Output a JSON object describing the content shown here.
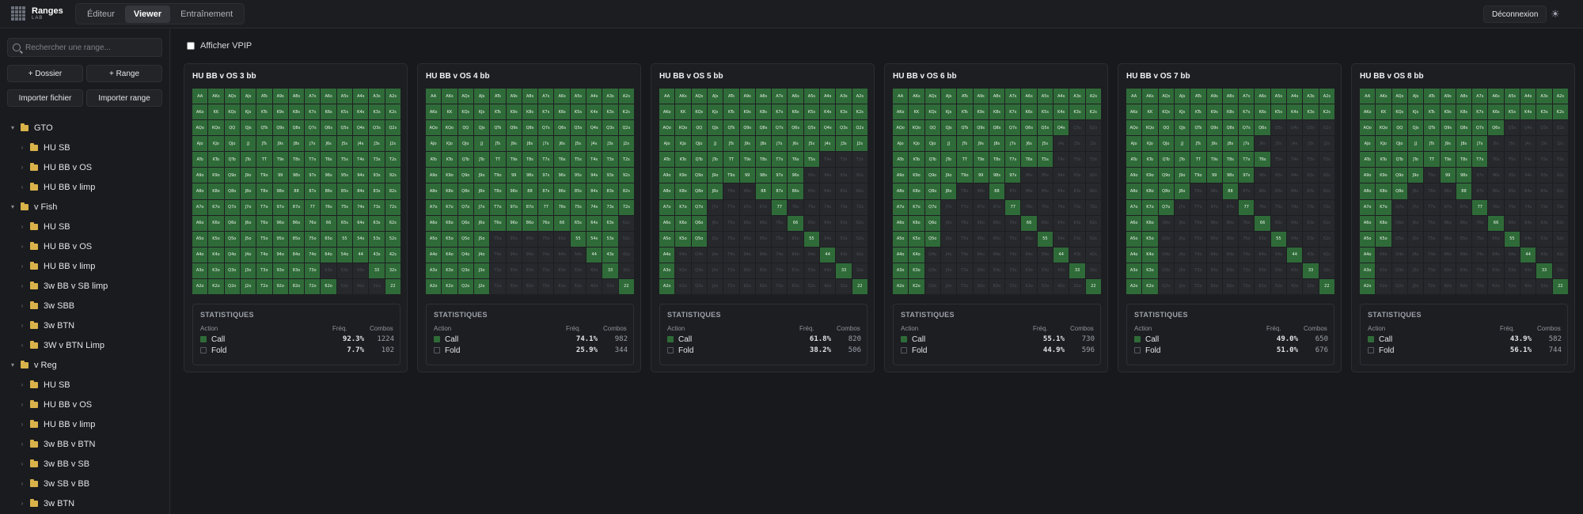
{
  "app": {
    "name": "Ranges",
    "sub": "LAB"
  },
  "nav": {
    "tabs": [
      "Éditeur",
      "Viewer",
      "Entraînement"
    ],
    "active": "Viewer"
  },
  "header": {
    "logout": "Déconnexion"
  },
  "sidebar": {
    "search_placeholder": "Rechercher une range...",
    "buttons": {
      "add_folder": "+ Dossier",
      "add_range": "+ Range",
      "import_file": "Importer fichier",
      "import_range": "Importer range"
    },
    "tree": [
      {
        "label": "GTO",
        "level": 0
      },
      {
        "label": "HU SB",
        "level": 1
      },
      {
        "label": "HU BB v OS",
        "level": 1
      },
      {
        "label": "HU BB v limp",
        "level": 1
      },
      {
        "label": "v Fish",
        "level": 0
      },
      {
        "label": "HU SB",
        "level": 1
      },
      {
        "label": "HU BB v OS",
        "level": 1
      },
      {
        "label": "HU BB v limp",
        "level": 1
      },
      {
        "label": "3w BB v SB limp",
        "level": 1
      },
      {
        "label": "3w SBB",
        "level": 1
      },
      {
        "label": "3w BTN",
        "level": 1
      },
      {
        "label": "3W v BTN Limp",
        "level": 1
      },
      {
        "label": "v Reg",
        "level": 0
      },
      {
        "label": "HU SB",
        "level": 1
      },
      {
        "label": "HU BB v OS",
        "level": 1
      },
      {
        "label": "HU BB v limp",
        "level": 1
      },
      {
        "label": "3w BB v BTN",
        "level": 1
      },
      {
        "label": "3w BB v SB",
        "level": 1
      },
      {
        "label": "3w SB v BB",
        "level": 1
      },
      {
        "label": "3w BTN",
        "level": 1
      }
    ]
  },
  "main": {
    "vpip_label": "Afficher VPIP"
  },
  "colors": {
    "call": "#2f6b38",
    "fold": "#26282c",
    "accent": "#d9b24a"
  },
  "labels": {
    "stats_title": "STATISTIQUES",
    "action": "Action",
    "freq": "Fréq.",
    "combos": "Combos"
  },
  "ranks": [
    "A",
    "K",
    "Q",
    "J",
    "T",
    "9",
    "8",
    "7",
    "6",
    "5",
    "4",
    "3",
    "2"
  ],
  "panels": [
    {
      "title": "HU BB v OS 3 bb",
      "fold_hands": [
        "63o",
        "53o",
        "43o",
        "52o",
        "42o",
        "32o"
      ],
      "stats": [
        {
          "action": "Call",
          "freq": "92.3%",
          "combos": "1224"
        },
        {
          "action": "Fold",
          "freq": "7.7%",
          "combos": "102"
        }
      ]
    },
    {
      "title": "HU BB v OS 4 bb",
      "fold_hands": [
        "62s",
        "52s",
        "42s",
        "32s",
        "T5o",
        "95o",
        "85o",
        "75o",
        "65o",
        "T4o",
        "94o",
        "84o",
        "74o",
        "64o",
        "54o",
        "T3o",
        "93o",
        "83o",
        "73o",
        "63o",
        "53o",
        "43o",
        "T2o",
        "92o",
        "82o",
        "72o",
        "62o",
        "52o",
        "42o",
        "32o"
      ],
      "stats": [
        {
          "action": "Call",
          "freq": "74.1%",
          "combos": "982"
        },
        {
          "action": "Fold",
          "freq": "25.9%",
          "combos": "344"
        }
      ]
    },
    {
      "title": "HU BB v OS 5 bb",
      "fold_hands": [
        "T2s",
        "92s",
        "82s",
        "72s",
        "62s",
        "52s",
        "42s",
        "32s",
        "T3s",
        "93s",
        "83s",
        "73s",
        "63s",
        "53s",
        "43s",
        "T4s",
        "94s",
        "84s",
        "74s",
        "64s",
        "54s",
        "95s",
        "85s",
        "75s",
        "65s",
        "76s",
        "J6o",
        "T6o",
        "96o",
        "86o",
        "76o",
        "J5o",
        "T5o",
        "95o",
        "85o",
        "75o",
        "65o",
        "J4o",
        "T4o",
        "94o",
        "84o",
        "74o",
        "64o",
        "54o",
        "J3o",
        "T3o",
        "93o",
        "83o",
        "73o",
        "63o",
        "53o",
        "43o",
        "J2o",
        "T2o",
        "92o",
        "82o",
        "72o",
        "62o",
        "52o",
        "42o",
        "32o",
        "K2o",
        "Q2o",
        "K3o",
        "Q3o",
        "K4o",
        "Q4o",
        "97o",
        "87o",
        "J7o",
        "T7o",
        "T8o",
        "98o"
      ],
      "stats": [
        {
          "action": "Call",
          "freq": "61.8%",
          "combos": "820"
        },
        {
          "action": "Fold",
          "freq": "38.2%",
          "combos": "506"
        }
      ]
    },
    {
      "title": "HU BB v OS 6 bb",
      "fold_hands": [
        "32s",
        "42s",
        "52s",
        "62s",
        "72s",
        "82s",
        "92s",
        "T2s",
        "43s",
        "53s",
        "63s",
        "73s",
        "83s",
        "93s",
        "T3s",
        "54s",
        "64s",
        "74s",
        "84s",
        "94s",
        "T4s",
        "65s",
        "75s",
        "85s",
        "95s",
        "76s",
        "86s",
        "96s",
        "87s",
        "J2s",
        "J3s",
        "J4s",
        "Q3s",
        "Q2s",
        "97o",
        "87o",
        "J7o",
        "T7o",
        "T8o",
        "98o",
        "J6o",
        "T6o",
        "96o",
        "86o",
        "76o",
        "J5o",
        "T5o",
        "95o",
        "85o",
        "75o",
        "65o",
        "J4o",
        "T4o",
        "94o",
        "84o",
        "74o",
        "64o",
        "54o",
        "Q4o",
        "J3o",
        "T3o",
        "93o",
        "83o",
        "73o",
        "63o",
        "53o",
        "43o",
        "Q3o",
        "Q2o",
        "J2o",
        "T2o",
        "92o",
        "82o",
        "72o",
        "62o",
        "52o",
        "42o",
        "32o"
      ],
      "stats": [
        {
          "action": "Call",
          "freq": "55.1%",
          "combos": "730"
        },
        {
          "action": "Fold",
          "freq": "44.9%",
          "combos": "596"
        }
      ]
    },
    {
      "title": "HU BB v OS 7 bb",
      "fold_hands": [
        "32s",
        "42s",
        "52s",
        "62s",
        "72s",
        "82s",
        "92s",
        "T2s",
        "J2s",
        "43s",
        "53s",
        "63s",
        "73s",
        "83s",
        "93s",
        "T3s",
        "J3s",
        "54s",
        "64s",
        "74s",
        "84s",
        "94s",
        "T4s",
        "J4s",
        "65s",
        "75s",
        "85s",
        "95s",
        "T5s",
        "76s",
        "86s",
        "96s",
        "87s",
        "Q2s",
        "Q3s",
        "Q4s",
        "Q5s",
        "J5s",
        "J6s",
        "97o",
        "87o",
        "J7o",
        "T7o",
        "T8o",
        "98o",
        "J6o",
        "T6o",
        "96o",
        "86o",
        "76o",
        "J5o",
        "T5o",
        "95o",
        "85o",
        "75o",
        "65o",
        "Q5o",
        "J4o",
        "T4o",
        "94o",
        "84o",
        "74o",
        "64o",
        "54o",
        "Q4o",
        "J3o",
        "T3o",
        "93o",
        "83o",
        "73o",
        "63o",
        "53o",
        "43o",
        "Q3o",
        "Q2o",
        "J2o",
        "T2o",
        "92o",
        "82o",
        "72o",
        "62o",
        "52o",
        "42o",
        "32o",
        "Q6o"
      ],
      "stats": [
        {
          "action": "Call",
          "freq": "49.0%",
          "combos": "650"
        },
        {
          "action": "Fold",
          "freq": "51.0%",
          "combos": "676"
        }
      ]
    },
    {
      "title": "HU BB v OS 8 bb",
      "fold_hands": [
        "32s",
        "42s",
        "52s",
        "62s",
        "72s",
        "82s",
        "92s",
        "T2s",
        "J2s",
        "43s",
        "53s",
        "63s",
        "73s",
        "83s",
        "93s",
        "T3s",
        "J3s",
        "54s",
        "64s",
        "74s",
        "84s",
        "94s",
        "T4s",
        "J4s",
        "65s",
        "75s",
        "85s",
        "95s",
        "T5s",
        "76s",
        "86s",
        "96s",
        "87s",
        "Q2s",
        "Q3s",
        "Q4s",
        "Q5s",
        "J5s",
        "J6s",
        "T6s",
        "97s",
        "97o",
        "87o",
        "J7o",
        "T7o",
        "T8o",
        "98o",
        "J6o",
        "T6o",
        "96o",
        "86o",
        "76o",
        "J5o",
        "T5o",
        "95o",
        "85o",
        "75o",
        "65o",
        "Q5o",
        "J4o",
        "T4o",
        "94o",
        "84o",
        "74o",
        "64o",
        "54o",
        "Q4o",
        "J3o",
        "T3o",
        "93o",
        "83o",
        "73o",
        "63o",
        "53o",
        "43o",
        "Q3o",
        "Q2o",
        "J2o",
        "T2o",
        "92o",
        "82o",
        "72o",
        "62o",
        "52o",
        "42o",
        "32o",
        "Q6o",
        "Q7o",
        "J8o",
        "T9o",
        "K2o",
        "K3o",
        "K4o"
      ],
      "stats": [
        {
          "action": "Call",
          "freq": "43.9%",
          "combos": "582"
        },
        {
          "action": "Fold",
          "freq": "56.1%",
          "combos": "744"
        }
      ]
    }
  ]
}
